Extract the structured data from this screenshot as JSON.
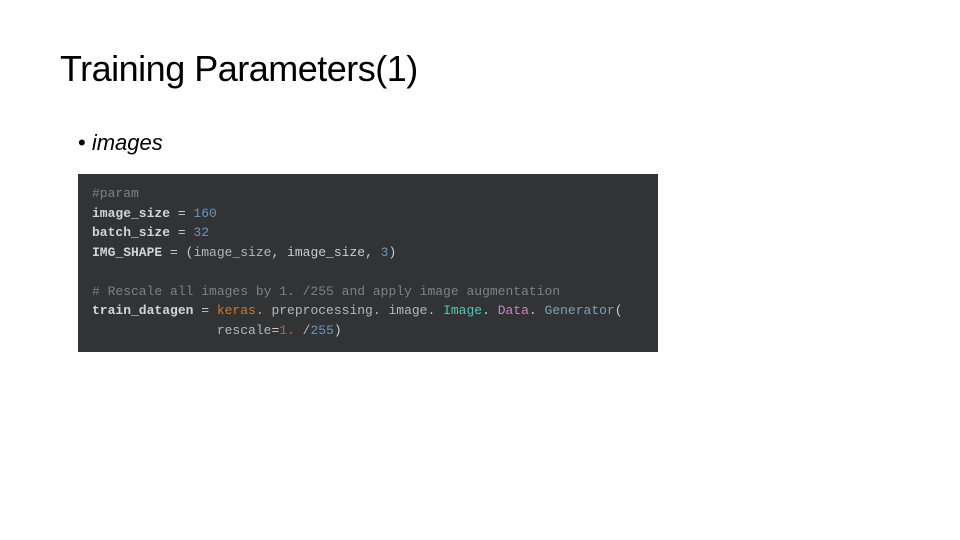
{
  "slide": {
    "title": "Training Parameters(1)",
    "bullet": "images"
  },
  "code": {
    "c0": "#param",
    "l1_a": "image_size",
    "l1_b": " = ",
    "l1_c": "160",
    "l2_a": "batch_size",
    "l2_b": " = ",
    "l2_c": "32",
    "l3_a": "IMG_SHAPE",
    "l3_b": " = ",
    "l3_c": "(",
    "l3_d": "image_size",
    "l3_e": ", image_size, ",
    "l3_f": "3",
    "l3_g": ")",
    "c1": "# Rescale all images by 1. /255 and apply image augmentation",
    "l5_a": "train_datagen",
    "l5_b": " = ",
    "l5_c": "keras",
    "l5_d": ". preprocessing. image. ",
    "l5_e": "Image",
    "l5_f": ". ",
    "l5_g": "Data",
    "l5_h": ". ",
    "l5_i": "Generator",
    "l5_j": "(",
    "l6_a": "                rescale",
    "l6_b": "=",
    "l6_c": "1.",
    "l6_d": " /",
    "l6_e": "255",
    "l6_f": ")"
  }
}
